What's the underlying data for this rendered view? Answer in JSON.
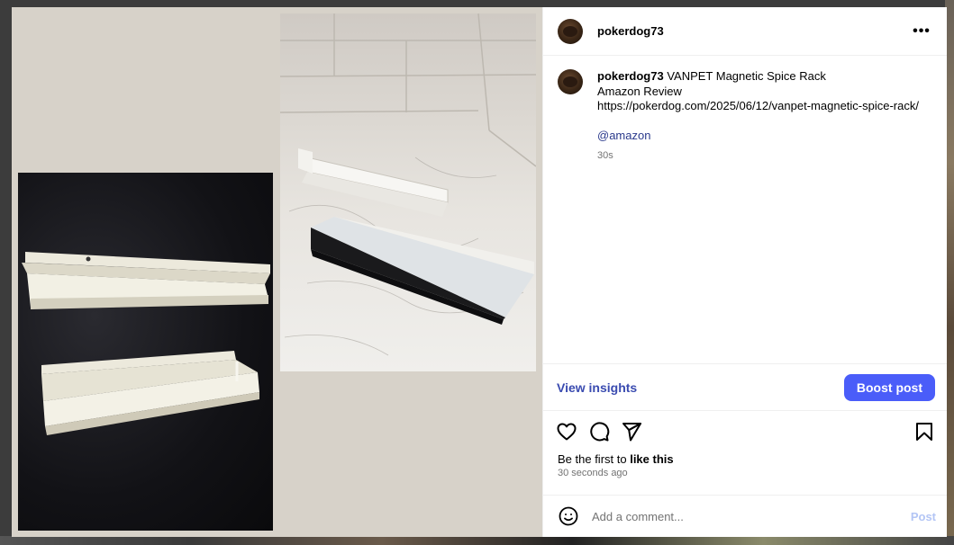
{
  "post": {
    "username": "pokerdog73",
    "caption_title": "VANPET Magnetic Spice Rack",
    "caption_line2": "Amazon Review",
    "caption_link": "https://pokerdog.com/2025/06/12/vanpet-magnetic-spice-rack/",
    "mention": "@amazon",
    "caption_time": "30s",
    "more_label": "•••"
  },
  "insights": {
    "view_label": "View insights",
    "boost_label": "Boost post"
  },
  "likes": {
    "prefix": "Be the first to ",
    "bold": "like this",
    "time_ago": "30 seconds ago"
  },
  "comment": {
    "placeholder": "Add a comment...",
    "post_label": "Post"
  },
  "icons": {
    "like": "heart-icon",
    "comment": "speech-bubble-icon",
    "share": "paper-plane-icon",
    "save": "bookmark-icon",
    "emoji": "smiley-icon",
    "more": "ellipsis-icon"
  },
  "colors": {
    "boost": "#4a5df9",
    "link": "#3a4bb0",
    "mention": "#2b3a8c",
    "post_disabled": "#b3c5f5"
  }
}
